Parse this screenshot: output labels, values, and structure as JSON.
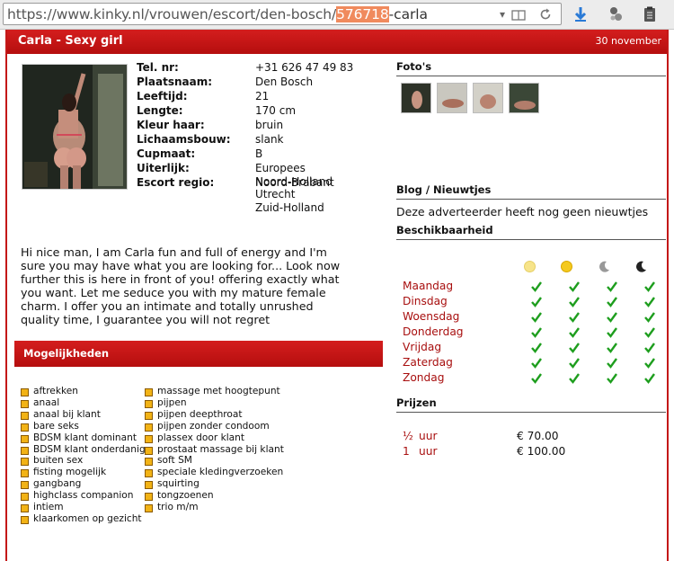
{
  "browser": {
    "url_prefix": "https://www.kinky.nl/vrouwen/escort/den-bosch/",
    "url_highlight": "576718",
    "url_suffix": "-carla"
  },
  "profile": {
    "title": "Carla - Sexy girl",
    "date": "30 november",
    "details": [
      {
        "label": "Tel. nr:",
        "value": "+31 626 47 49 83"
      },
      {
        "label": "Plaatsnaam:",
        "value": "Den Bosch"
      },
      {
        "label": "Leeftijd:",
        "value": "21"
      },
      {
        "label": "Lengte:",
        "value": "170 cm"
      },
      {
        "label": "Kleur haar:",
        "value": "bruin"
      },
      {
        "label": "Lichaamsbouw:",
        "value": "slank"
      },
      {
        "label": "Cupmaat:",
        "value": "B"
      },
      {
        "label": "Uiterlijk:",
        "value": "Europees"
      },
      {
        "label": "Escort regio:",
        "value": "Noord-Brabant"
      }
    ],
    "regions_extra": [
      "Noord-Holland",
      "Utrecht",
      "Zuid-Holland"
    ],
    "description": "Hi nice man, I am Carla fun and full of energy and I'm sure you may have what you are looking for... Look now further this is here in front of you! offering exactly what you want. Let me seduce you with my mature female charm. I offer you an intimate and totally unrushed quality time, I guarantee you will not regret"
  },
  "mogelijkheden": {
    "heading": "Mogelijkheden",
    "col1": [
      "aftrekken",
      "anaal",
      "anaal bij klant",
      "bare seks",
      "BDSM klant dominant",
      "BDSM klant onderdanig",
      "buiten sex",
      "fisting mogelijk",
      "gangbang",
      "highclass companion",
      "intiem",
      "klaarkomen op gezicht"
    ],
    "col2": [
      "massage met hoogtepunt",
      "pijpen",
      "pijpen deepthroat",
      "pijpen zonder condoom",
      "plassex door klant",
      "prostaat massage bij klant",
      "soft SM",
      "speciale kledingverzoeken",
      "squirting",
      "tongzoenen",
      "trio m/m"
    ]
  },
  "right": {
    "fotos_heading": "Foto's",
    "blog_heading": "Blog / Nieuwtjes",
    "blog_text": "Deze adverteerder heeft nog geen nieuwtjes",
    "availability_heading": "Beschikbaarheid",
    "days": [
      "Maandag",
      "Dinsdag",
      "Woensdag",
      "Donderdag",
      "Vrijdag",
      "Zaterdag",
      "Zondag"
    ],
    "prices_heading": "Prijzen",
    "prices": [
      {
        "qty": "½",
        "unit": "uur",
        "amount": "€ 70.00"
      },
      {
        "qty": "1",
        "unit": "uur",
        "amount": "€ 100.00"
      }
    ]
  },
  "colors": {
    "accent_red": "#c41818",
    "day_red": "#a80f0f",
    "check_green": "#1e9e1e",
    "bullet": "#f2b316"
  }
}
